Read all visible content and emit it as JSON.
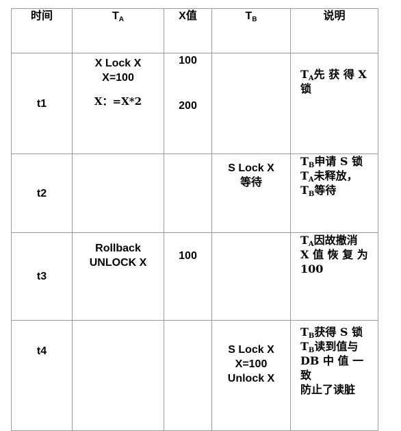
{
  "headers": {
    "time": "时间",
    "ta": "T",
    "ta_sub": "A",
    "xval": "X值",
    "tb": "T",
    "tb_sub": "B",
    "desc": "说明"
  },
  "rows": [
    {
      "time": "t1",
      "ta_lines": [
        "X Lock X",
        "X=100"
      ],
      "ta_extra": "X：=X*2",
      "x_values": [
        "100",
        "200"
      ],
      "tb_lines": [],
      "desc": [
        {
          "t": "T",
          "sub": "A",
          "text": "先 获 得 X"
        },
        {
          "text": "锁"
        }
      ]
    },
    {
      "time": "t2",
      "ta_lines": [],
      "x_values": [],
      "tb_lines": [
        "S Lock X",
        "等待"
      ],
      "desc": [
        {
          "t": "T",
          "sub": "B",
          "text": "申请 S 锁"
        },
        {
          "t": "T",
          "sub": "A",
          "text": "未释放，"
        },
        {
          "t": "T",
          "sub": "B",
          "text": "等待"
        }
      ]
    },
    {
      "time": "t3",
      "ta_lines": [
        "Rollback",
        "UNLOCK X"
      ],
      "x_values": [
        "100"
      ],
      "tb_lines": [],
      "desc": [
        {
          "t": "T",
          "sub": "A",
          "text": "因故撤消"
        },
        {
          "text": "X 值 恢 复 为"
        },
        {
          "text": "100"
        }
      ]
    },
    {
      "time": "t4",
      "ta_lines": [],
      "x_values": [],
      "tb_lines": [
        "S Lock X",
        "X=100",
        "Unlock X"
      ],
      "desc": [
        {
          "t": "T",
          "sub": "B",
          "text": "获得 S 锁"
        },
        {
          "t": "T",
          "sub": "B",
          "text": "读到值与"
        },
        {
          "text": "DB 中 值 一"
        },
        {
          "text": "致"
        },
        {
          "text": "防止了读脏"
        }
      ]
    }
  ]
}
